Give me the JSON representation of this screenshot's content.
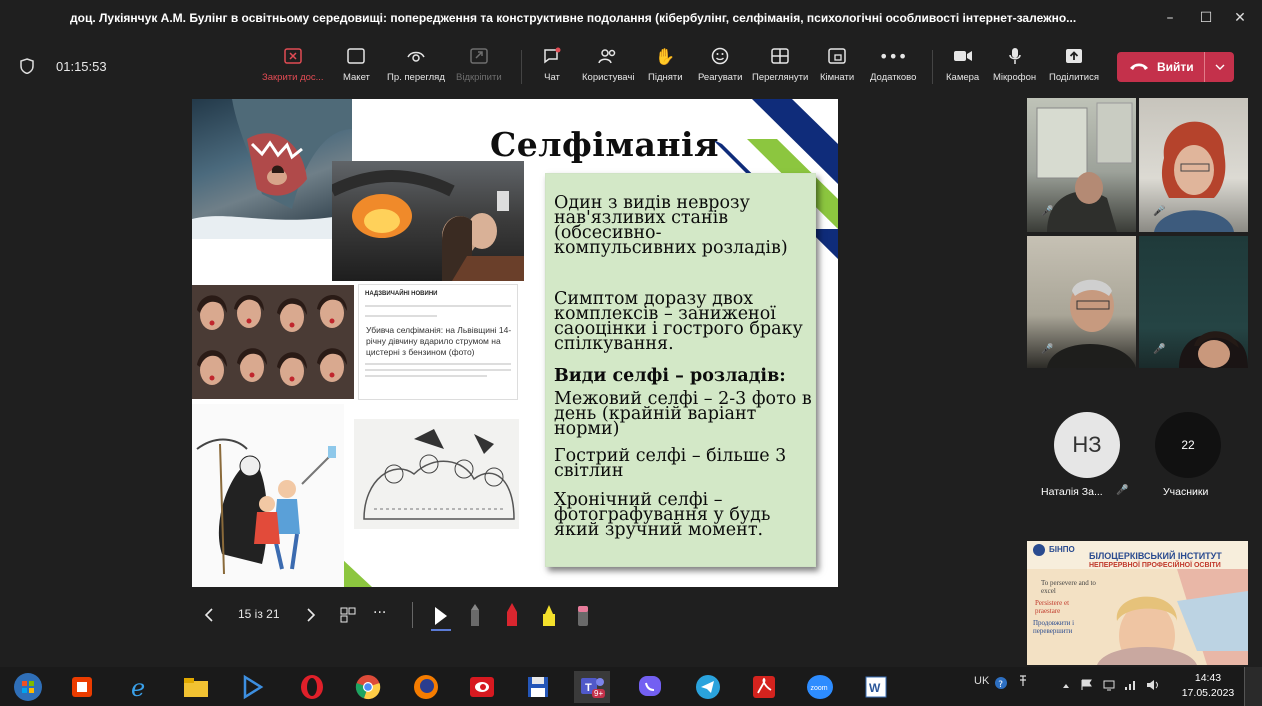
{
  "window": {
    "title": "доц. Лукіянчук А.М. Булінг в освітньому середовищі: попередження та конструктивне подолання (кібербулінг, селфіманія, психологічні особливості інтернет-залежно...",
    "controls": {
      "minimize": "–",
      "maximize": "☐",
      "close": "✕"
    }
  },
  "toolbar": {
    "timer": "01:15:53",
    "buttons": [
      {
        "label": "Закрити дос...",
        "icon": "close-share-icon"
      },
      {
        "label": "Макет",
        "icon": "layout-icon"
      },
      {
        "label": "Пр. перегляд",
        "icon": "eye-icon"
      },
      {
        "label": "Відкріпити",
        "icon": "unpin-icon"
      },
      {
        "label": "Чат",
        "icon": "chat-icon"
      },
      {
        "label": "Користувачі",
        "icon": "people-icon"
      },
      {
        "label": "Підняти",
        "icon": "raise-hand-icon"
      },
      {
        "label": "Реагувати",
        "icon": "smile-icon"
      },
      {
        "label": "Переглянути",
        "icon": "grid-icon"
      },
      {
        "label": "Кімнати",
        "icon": "rooms-icon"
      },
      {
        "label": "Додатково",
        "icon": "more-icon"
      },
      {
        "label": "Камера",
        "icon": "camera-icon"
      },
      {
        "label": "Мікрофон",
        "icon": "microphone-icon"
      },
      {
        "label": "Поділитися",
        "icon": "share-icon"
      }
    ],
    "leave_label": "Вийти"
  },
  "slide": {
    "title": "Селфіманія",
    "paragraphs": [
      "Один з видів неврозу нав'язливих станів (обсесивно-компульсивних розладів)",
      "Симптом доразу двох комплексів – заниженої саооцінки і гострого браку спілкування.",
      "Види селфі – розладів:",
      "Межовий селфі – 2-3 фото в день (крайній варіант норми)",
      "Гострий селфі – більше 3 світлин",
      "Хронічний селфі – фотографування у будь який зручний момент."
    ],
    "news": {
      "site": "НАДЗВИЧАЙНІ НОВИНИ",
      "headline": "Убивча селфіманія: на Львівщині 14-річну дівчину вдарило струмом на цистерні з бензином (фото)"
    }
  },
  "slide_controls": {
    "page": "15 із 21",
    "more": "···"
  },
  "participants": {
    "avatar_initials": "НЗ",
    "avatar_name": "Наталія За...",
    "count": "22",
    "count_label": "Учасники"
  },
  "institute": {
    "abbr": "БІНПО",
    "name": "БІЛОЦЕРКІВСЬКИЙ ІНСТИТУТ",
    "sub": "НЕПЕРЕРВНОЇ ПРОФЕСІЙНОЇ ОСВІТИ",
    "motto1": "To persevere and to excel",
    "motto2": "Persistere et praestare",
    "motto3": "Продовжити і перевершити"
  },
  "taskbar": {
    "lang": "UK",
    "time": "14:43",
    "date": "17.05.2023",
    "teams_badge": "9+"
  }
}
